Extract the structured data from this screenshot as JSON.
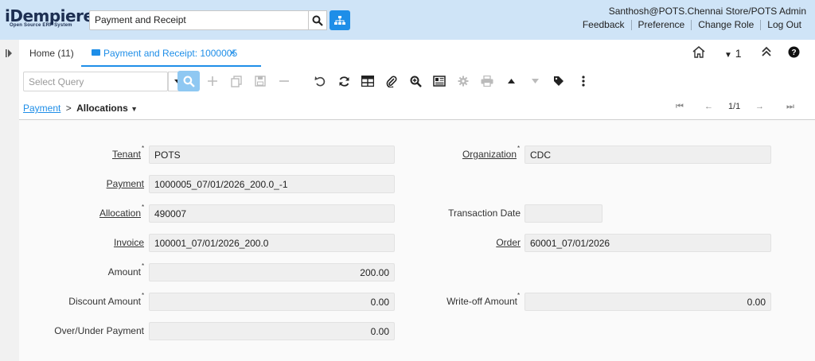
{
  "header": {
    "logo_main": "iDempiere",
    "logo_sub": "Open Source ERP System",
    "search_value": "Payment and Receipt",
    "user": "Santhosh@POTS.Chennai Store/POTS Admin",
    "links": [
      "Feedback",
      "Preference",
      "Change Role",
      "Log Out"
    ]
  },
  "tabs": {
    "home": "Home (11)",
    "active": "Payment and Receipt: 1000005",
    "window_count": "1"
  },
  "toolbar": {
    "query_placeholder": "Select Query"
  },
  "breadcrumb": {
    "parent": "Payment",
    "separator": ">",
    "current": "Allocations",
    "record_nav": "1/1"
  },
  "form": {
    "tenant_label": "Tenant",
    "tenant_value": "POTS",
    "organization_label": "Organization",
    "organization_value": "CDC",
    "payment_label": "Payment",
    "payment_value": "1000005_07/01/2026_200.0_-1",
    "allocation_label": "Allocation",
    "allocation_value": "490007",
    "transaction_date_label": "Transaction Date",
    "transaction_date_value": "",
    "invoice_label": "Invoice",
    "invoice_value": "100001_07/01/2026_200.0",
    "order_label": "Order",
    "order_value": "60001_07/01/2026",
    "amount_label": "Amount",
    "amount_value": "200.00",
    "discount_label": "Discount Amount",
    "discount_value": "0.00",
    "writeoff_label": "Write-off Amount",
    "writeoff_value": "0.00",
    "overunder_label": "Over/Under Payment",
    "overunder_value": "0.00"
  },
  "colors": {
    "accent": "#1e8ee8",
    "header_bg": "#cfe4f7"
  }
}
